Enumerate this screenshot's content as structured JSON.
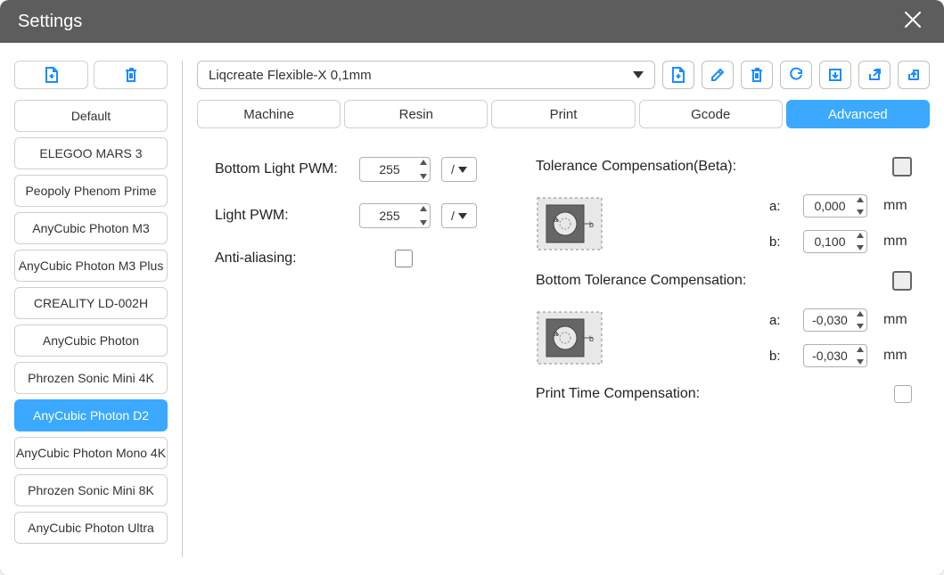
{
  "title": "Settings",
  "sidebar": {
    "items": [
      {
        "label": "Default"
      },
      {
        "label": "ELEGOO MARS 3"
      },
      {
        "label": "Peopoly Phenom Prime"
      },
      {
        "label": "AnyCubic Photon M3"
      },
      {
        "label": "AnyCubic Photon M3 Plus"
      },
      {
        "label": "CREALITY LD-002H"
      },
      {
        "label": "AnyCubic Photon"
      },
      {
        "label": "Phrozen Sonic Mini 4K"
      },
      {
        "label": "AnyCubic Photon D2"
      },
      {
        "label": "AnyCubic Photon Mono 4K"
      },
      {
        "label": "Phrozen Sonic Mini 8K"
      },
      {
        "label": "AnyCubic Photon Ultra"
      }
    ],
    "selected_index": 8
  },
  "profile": {
    "selected": "Liqcreate Flexible-X 0,1mm"
  },
  "tabs": {
    "items": [
      {
        "label": "Machine"
      },
      {
        "label": "Resin"
      },
      {
        "label": "Print"
      },
      {
        "label": "Gcode"
      },
      {
        "label": "Advanced"
      }
    ],
    "selected_index": 4
  },
  "form": {
    "bottom_light_pwm": {
      "label": "Bottom Light PWM:",
      "value": "255",
      "extra": "/"
    },
    "light_pwm": {
      "label": "Light PWM:",
      "value": "255",
      "extra": "/"
    },
    "anti_aliasing": {
      "label": "Anti-aliasing:"
    },
    "tolerance": {
      "label": "Tolerance Compensation(Beta):",
      "a_label": "a:",
      "a_value": "0,000",
      "b_label": "b:",
      "b_value": "0,100"
    },
    "bottom_tolerance": {
      "label": "Bottom Tolerance Compensation:",
      "a_label": "a:",
      "a_value": "-0,030",
      "b_label": "b:",
      "b_value": "-0,030"
    },
    "print_time": {
      "label": "Print Time Compensation:"
    },
    "unit": "mm"
  }
}
